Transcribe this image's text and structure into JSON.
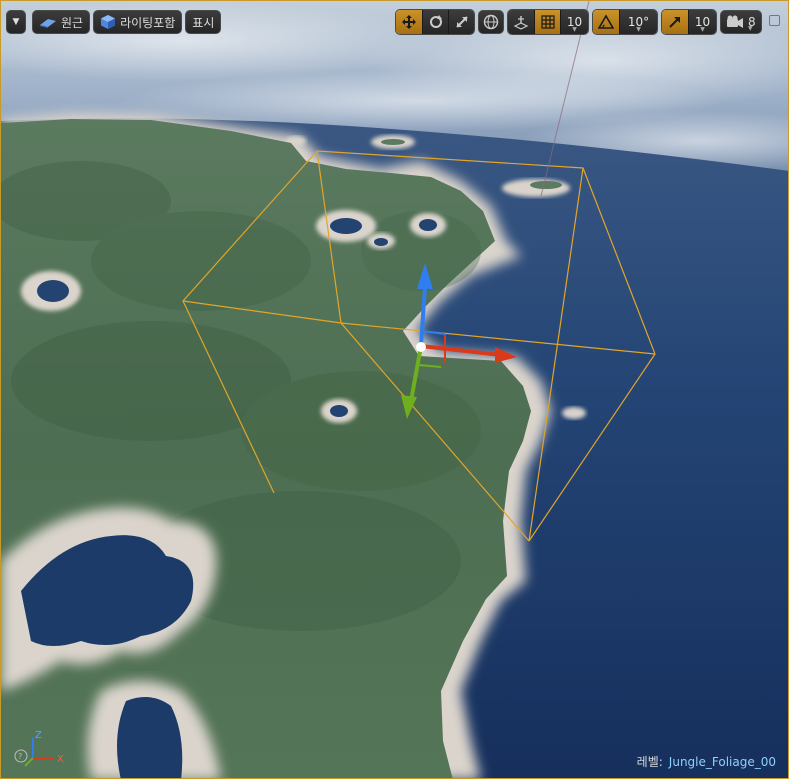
{
  "toolbar": {
    "perspective_label": "원근",
    "lighting_label": "라이팅포함",
    "show_label": "표시",
    "grid_snap_value": "10",
    "rotation_snap_value": "10°",
    "scale_snap_value": "10",
    "camera_speed_value": "8"
  },
  "icons": {
    "menu": "chevron-down-icon",
    "perspective": "perspective-cube-icon",
    "lighting": "lit-sphere-icon",
    "translate": "translate-move-icon",
    "rotate": "rotate-icon",
    "scale": "scale-icon",
    "world": "globe-icon",
    "surface_snap": "surface-snap-icon",
    "grid": "grid-icon",
    "angle": "angle-icon",
    "scale_snap": "scale-arrow-icon",
    "camera": "camera-icon",
    "maximize": "maximize-icon"
  },
  "level": {
    "prefix": "레벨:",
    "name": "Jungle_Foliage_00"
  },
  "axis_widget": {
    "x_label": "X",
    "z_label": "Z"
  },
  "colors": {
    "accent": "#c9932a",
    "axis_x": "#d93a1c",
    "axis_y": "#6fae1e",
    "axis_z": "#2f7ef0",
    "bounds": "#e1a52a"
  }
}
